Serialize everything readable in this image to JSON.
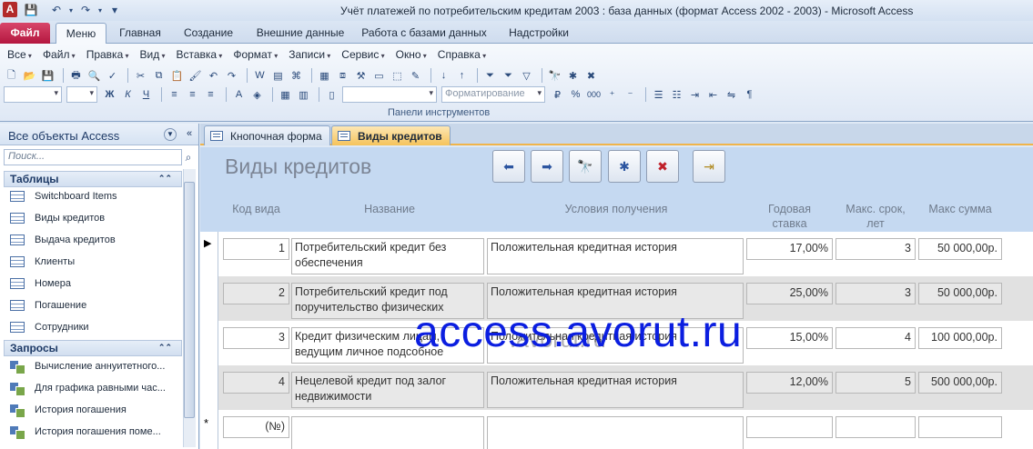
{
  "window": {
    "title": "Учёт платежей по потребительским кредитам 2003 : база данных (формат Access 2002 - 2003)  -  Microsoft Access",
    "app_icon_letter": "A"
  },
  "ribbon_tabs": [
    {
      "label": "Файл"
    },
    {
      "label": "Меню"
    },
    {
      "label": "Главная"
    },
    {
      "label": "Создание"
    },
    {
      "label": "Внешние данные"
    },
    {
      "label": "Работа с базами данных"
    },
    {
      "label": "Надстройки"
    }
  ],
  "ribbon": {
    "menus": [
      "Все",
      "Файл",
      "Правка",
      "Вид",
      "Вставка",
      "Формат",
      "Записи",
      "Сервис",
      "Окно",
      "Справка"
    ],
    "format_combo": "Форматирование",
    "group_label": "Панели инструментов"
  },
  "nav": {
    "title": "Все объекты Access",
    "search_placeholder": "Поиск...",
    "groups": [
      {
        "label": "Таблицы",
        "items": [
          "Switchboard Items",
          "Виды кредитов",
          "Выдача кредитов",
          "Клиенты",
          "Номера",
          "Погашение",
          "Сотрудники"
        ]
      },
      {
        "label": "Запросы",
        "items": [
          "Вычисление аннуитетного...",
          "Для графика равными час...",
          "История погашения",
          "История погашения поме..."
        ]
      }
    ]
  },
  "doc_tabs": [
    {
      "label": "Кнопочная форма"
    },
    {
      "label": "Виды кредитов"
    }
  ],
  "form": {
    "title": "Виды кредитов",
    "columns": {
      "code": "Код вида",
      "name": "Название",
      "conditions": "Условия получения",
      "rate_1": "Годовая",
      "rate_2": "ставка",
      "term_1": "Макс. срок,",
      "term_2": "лет",
      "sum": "Макс сумма"
    },
    "rows": [
      {
        "code": "1",
        "name": "Потребительский кредит без обеспечения",
        "conditions": "Положительная кредитная история",
        "rate": "17,00%",
        "term": "3",
        "sum": "50 000,00р."
      },
      {
        "code": "2",
        "name": "Потребительский кредит под поручительство физических",
        "conditions": "Положительная кредитная история",
        "rate": "25,00%",
        "term": "3",
        "sum": "50 000,00р."
      },
      {
        "code": "3",
        "name": "Кредит физическим лицам, ведущим личное подсобное",
        "conditions": "Положительная кредитная история",
        "rate": "15,00%",
        "term": "4",
        "sum": "100 000,00р."
      },
      {
        "code": "4",
        "name": "Нецелевой кредит под залог недвижимости",
        "conditions": "Положительная кредитная история",
        "rate": "12,00%",
        "term": "5",
        "sum": "500 000,00р."
      }
    ],
    "new_row_code": "(№)",
    "current_marker": "▶",
    "new_marker": "*"
  },
  "watermark": "access.avorut.ru",
  "watermark_shadow": ".avorut.ru"
}
